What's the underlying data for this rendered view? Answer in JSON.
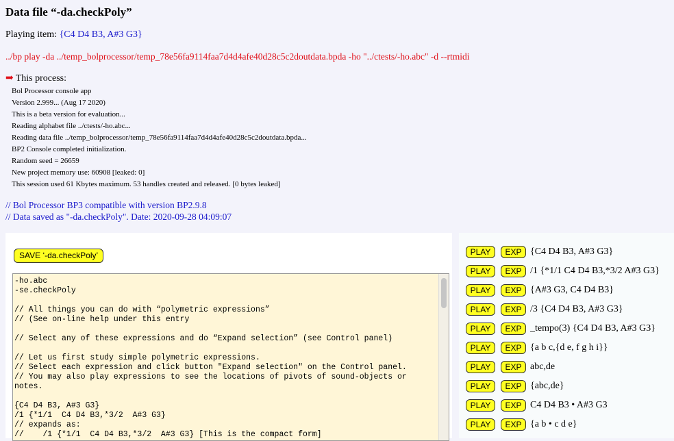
{
  "title": "Data file “-da.checkPoly”",
  "playing": {
    "label": "Playing item:",
    "item": "{C4 D4 B3, A#3 G3}"
  },
  "command": "../bp play -da ../temp_bolprocessor/temp_78e56fa9114faa7d4d4afe40d28c5c2doutdata.bpda -ho \"../ctests/-ho.abc\" -d --rtmidi",
  "process": {
    "label": "This process:",
    "lines": [
      "Bol Processor console app",
      "Version 2.999... (Aug 17 2020)",
      "This is a beta version for evaluation...",
      "Reading alphabet file ../ctests/-ho.abc...",
      "Reading data file ../temp_bolprocessor/temp_78e56fa9114faa7d4d4afe40d28c5c2doutdata.bpda...",
      "BP2 Console completed initialization.",
      "Random seed = 26659",
      "New project memory use: 60908 [leaked: 0]",
      "This session used 61 Kbytes maximum. 53 handles created and released. [0 bytes leaked]"
    ]
  },
  "compat": {
    "line1": "// Bol Processor BP3 compatible with version BP2.9.8",
    "line2": "// Data saved as \"-da.checkPoly\". Date: 2020-09-28 04:09:07"
  },
  "save_button": "SAVE ‘-da.checkPoly’",
  "editor_text": "-ho.abc\n-se.checkPoly\n\n// All things you can do with “polymetric expressions”\n// (See on-line help under this entry\n\n// Select any of these expressions and do “Expand selection” (see Control panel)\n\n// Let us first study simple polymetric expressions.\n// Select each expression and click button \"Expand selection\" on the Control panel.\n// You may also play expressions to see the locations of pivots of sound-objects or notes.\n\n{C4 D4 B3, A#3 G3}\n/1 {*1/1  C4 D4 B3,*3/2  A#3 G3}\n// expands as:\n//    /1 {*1/1  C4 D4 B3,*3/2  A#3 G3} [This is the compact form]",
  "items": [
    {
      "play": "PLAY",
      "exp": "EXP",
      "expr": "{C4 D4 B3, A#3 G3}"
    },
    {
      "play": "PLAY",
      "exp": "EXP",
      "expr": "/1 {*1/1 C4 D4 B3,*3/2 A#3 G3}"
    },
    {
      "play": "PLAY",
      "exp": "EXP",
      "expr": "{A#3 G3, C4 D4 B3}"
    },
    {
      "play": "PLAY",
      "exp": "EXP",
      "expr": "/3 {C4 D4 B3, A#3 G3}"
    },
    {
      "play": "PLAY",
      "exp": "EXP",
      "expr": "_tempo(3) {C4 D4 B3, A#3 G3}"
    },
    {
      "play": "PLAY",
      "exp": "EXP",
      "expr": "{a b c,{d e, f g h i}}"
    },
    {
      "play": "PLAY",
      "exp": "EXP",
      "expr": "abc,de"
    },
    {
      "play": "PLAY",
      "exp": "EXP",
      "expr": "{abc,de}"
    },
    {
      "play": "PLAY",
      "exp": "EXP",
      "expr": "C4 D4 B3 • A#3 G3"
    },
    {
      "play": "PLAY",
      "exp": "EXP",
      "expr": "{a b • c d e}"
    }
  ]
}
